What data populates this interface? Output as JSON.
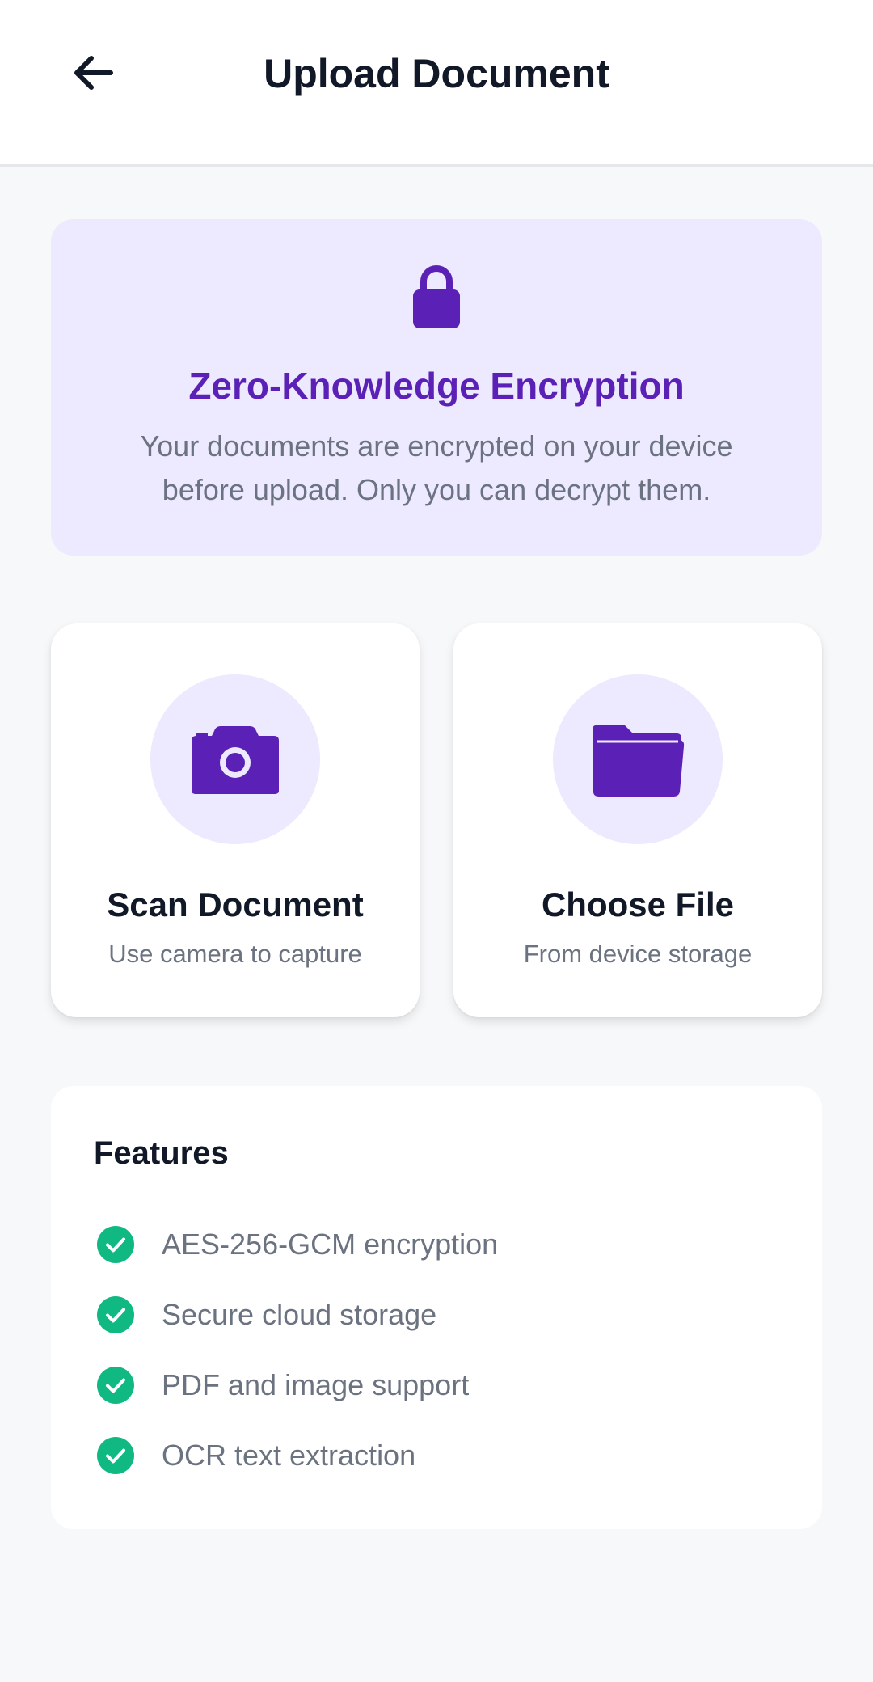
{
  "header": {
    "title": "Upload Document",
    "back_icon": "arrow-left-icon"
  },
  "banner": {
    "icon": "lock-icon",
    "title": "Zero-Knowledge Encryption",
    "description": "Your documents are encrypted on your device before upload. Only you can decrypt them."
  },
  "actions": {
    "scan": {
      "icon": "camera-icon",
      "title": "Scan Document",
      "subtitle": "Use camera to capture"
    },
    "choose": {
      "icon": "folder-icon",
      "title": "Choose File",
      "subtitle": "From device storage"
    }
  },
  "features": {
    "title": "Features",
    "items": [
      {
        "label": "AES-256-GCM encryption",
        "icon": "check-circle-icon"
      },
      {
        "label": "Secure cloud storage",
        "icon": "check-circle-icon"
      },
      {
        "label": "PDF and image support",
        "icon": "check-circle-icon"
      },
      {
        "label": "OCR text extraction",
        "icon": "check-circle-icon"
      }
    ]
  },
  "colors": {
    "accent": "#5B21B6",
    "accent_light": "#EDE9FE",
    "success": "#10B981",
    "text_primary": "#111827",
    "text_secondary": "#6B7280",
    "background": "#F7F8FA"
  }
}
